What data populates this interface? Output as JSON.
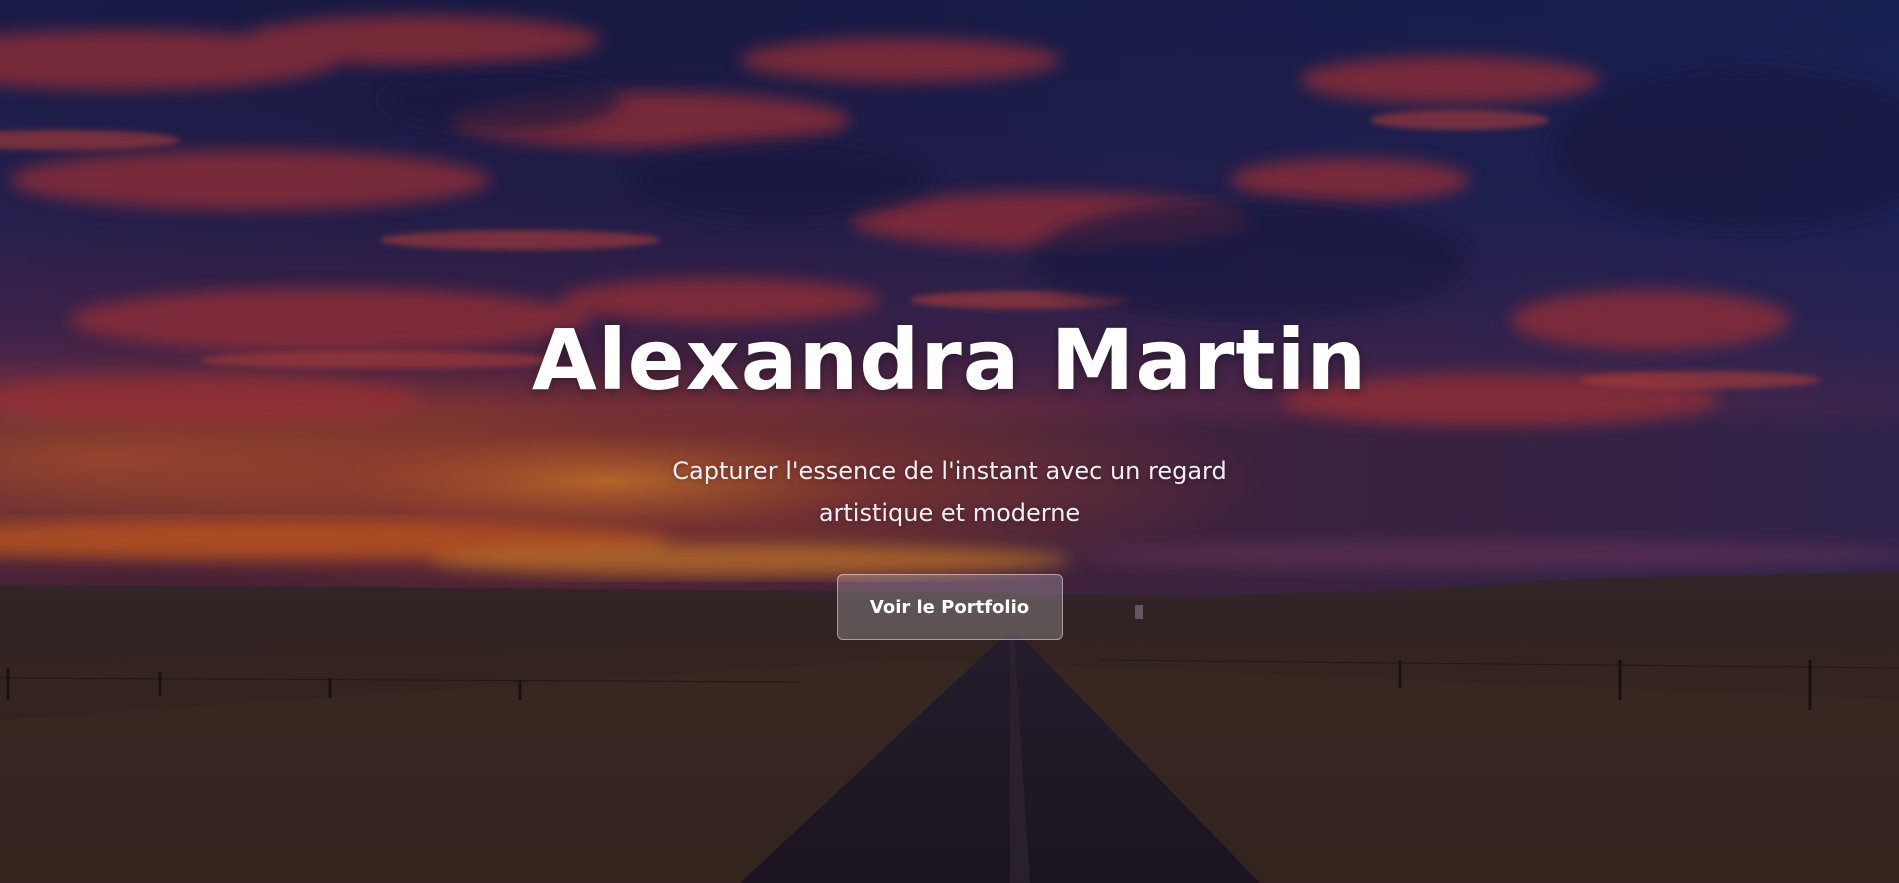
{
  "hero": {
    "title": "Alexandra Martin",
    "subtitle": "Capturer l'essence de l'instant avec un regard artistique et moderne",
    "cta_label": "Voir le Portfolio"
  },
  "colors": {
    "sky_top": "#1e2250",
    "sky_red": "#b03a35",
    "sunset_orange": "#e0641e",
    "ground": "#2a1f1d",
    "text": "#ffffff"
  }
}
